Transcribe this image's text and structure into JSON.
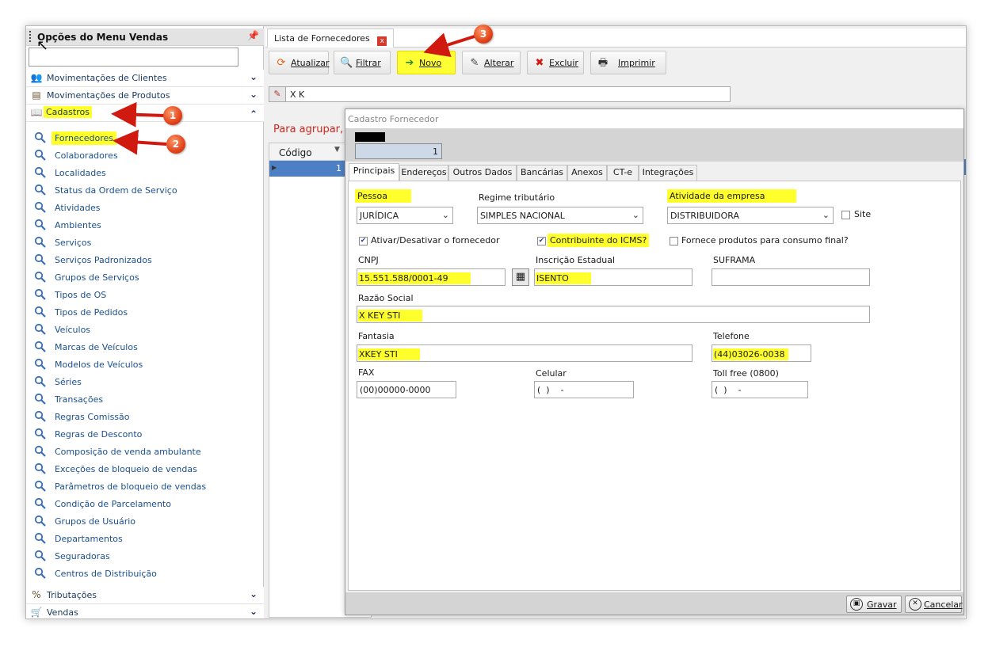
{
  "menu": {
    "title": "Opções do Menu Vendas",
    "pin": "📌",
    "search_value": "",
    "groups": {
      "movclientes": "Movimentações de Clientes",
      "movprodutos": "Movimentações de Produtos",
      "cadastros": "Cadastros",
      "tributacoes": "Tributações",
      "vendas": "Vendas"
    },
    "items": [
      "Fornecedores",
      "Colaboradores",
      "Localidades",
      "Status da Ordem de Serviço",
      "Atividades",
      "Ambientes",
      "Serviços",
      "Serviços Padronizados",
      "Grupos de Serviços",
      "Tipos de OS",
      "Tipos de Pedidos",
      "Veículos",
      "Marcas de Veículos",
      "Modelos de Veículos",
      "Séries",
      "Transações",
      "Regras Comissão",
      "Regras de Desconto",
      "Composição de venda ambulante",
      "Exceções de bloqueio de vendas",
      "Parâmetros de bloqueio de vendas",
      "Condição de Parcelamento",
      "Grupos de Usuário",
      "Departamentos",
      "Seguradoras",
      "Centros de Distribuição"
    ]
  },
  "tab": {
    "label": "Lista de Fornecedores",
    "close": "x"
  },
  "toolbar": {
    "atualizar": "Atualizar",
    "filtrar": "Filtrar",
    "novo": "Novo",
    "alterar": "Alterar",
    "excluir": "Excluir",
    "imprimir": "Imprimir"
  },
  "filter": {
    "value": "X K"
  },
  "grouping_message": "Para agrupar, a",
  "grid": {
    "column": "Código",
    "row_value": "1"
  },
  "dialog": {
    "title": "Cadastro Fornecedor",
    "code": "1",
    "tabs": [
      "Principais",
      "Endereços",
      "Outros Dados",
      "Bancárias",
      "Anexos",
      "CT-e",
      "Integrações"
    ],
    "fields": {
      "pessoa_label": "Pessoa",
      "pessoa_value": "JURÍDICA",
      "regime_label": "Regime tributário",
      "regime_value": "SIMPLES NACIONAL",
      "atividade_label": "Atividade da empresa",
      "atividade_value": "DISTRIBUIDORA",
      "site_label": "Site",
      "ativar_label": "Ativar/Desativar o fornecedor",
      "contribuinte_label": "Contribuinte do ICMS?",
      "fornece_label": "Fornece produtos para consumo final?",
      "cnpj_label": "CNPJ",
      "cnpj_value": "15.551.588/0001-49",
      "ie_label": "Inscrição Estadual",
      "ie_value": "ISENTO",
      "suframa_label": "SUFRAMA",
      "suframa_value": "",
      "razao_label": "Razão Social",
      "razao_value": "X KEY STI",
      "fantasia_label": "Fantasia",
      "fantasia_value": "XKEY STI",
      "telefone_label": "Telefone",
      "telefone_value": "(44)03026-0038",
      "fax_label": "FAX",
      "fax_value": "(00)00000-0000",
      "celular_label": "Celular",
      "celular_value": "(  )    -",
      "tollfree_label": "Toll free (0800)",
      "tollfree_value": "(  )    -"
    },
    "checkboxes": {
      "site": false,
      "ativar": true,
      "contribuinte": true,
      "fornece": false
    },
    "buttons": {
      "gravar": "Gravar",
      "cancelar": "Cancelar"
    }
  },
  "annotations": [
    "1",
    "2",
    "3"
  ],
  "colors": {
    "highlight": "#ffff2b",
    "arrow": "#d01a10",
    "selection": "#4d7fc4",
    "message": "#d0271f"
  }
}
